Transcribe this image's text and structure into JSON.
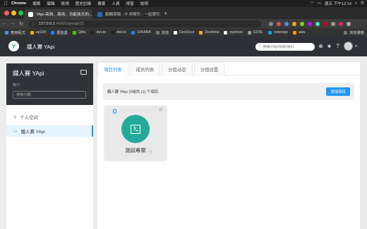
{
  "os_menubar": {
    "app": "Chrome",
    "menus": [
      "檔案",
      "編輯",
      "檢視",
      "歷史記錄",
      "書籤",
      "人員",
      "視窗",
      "說明"
    ],
    "clock": "週五 下午12:14"
  },
  "browser": {
    "tabs": [
      {
        "label": "YApi-高效、易用、功能強大的..."
      },
      {
        "label": "編輯草稿 - IT 邦幫忙 - 一起幫忙..."
      }
    ],
    "url_host": "127.0.0.1",
    "url_path": ":40001/group/23",
    "bookmarks": [
      "應用程式",
      "ep104",
      "掘金盞",
      "Qiita",
      "dev.to",
      "dev.to",
      "104JIRA",
      "其他",
      "DevDocs",
      "Devhints",
      "pysheet",
      "GOSL",
      "notes/go",
      "aws"
    ],
    "other_bookmarks": "其他書籤"
  },
  "header": {
    "logo_glyph": "Y",
    "brand": "鐵人賽 YApi",
    "search_placeholder": "搜索分組/項目/接口"
  },
  "sidebar": {
    "group_title": "鐵人賽 YApi",
    "intro_label": "簡介:",
    "search_placeholder": "搜索分類",
    "items": [
      {
        "label": "个人空间",
        "icon": "user-icon"
      },
      {
        "label": "鐵人賽 YApi",
        "icon": "folder-icon"
      }
    ]
  },
  "main": {
    "tabs": [
      "項目列表",
      "成员列表",
      "分组动态",
      "分组设置"
    ],
    "summary": "鐵人賽 YApi 分組共 (1) 个項目",
    "add_button": "添加項目",
    "projects": [
      {
        "name": "測試專案"
      }
    ]
  },
  "colors": {
    "accent": "#2395f1",
    "project_logo": "#25a99b",
    "header_bg": "#2d3035"
  }
}
